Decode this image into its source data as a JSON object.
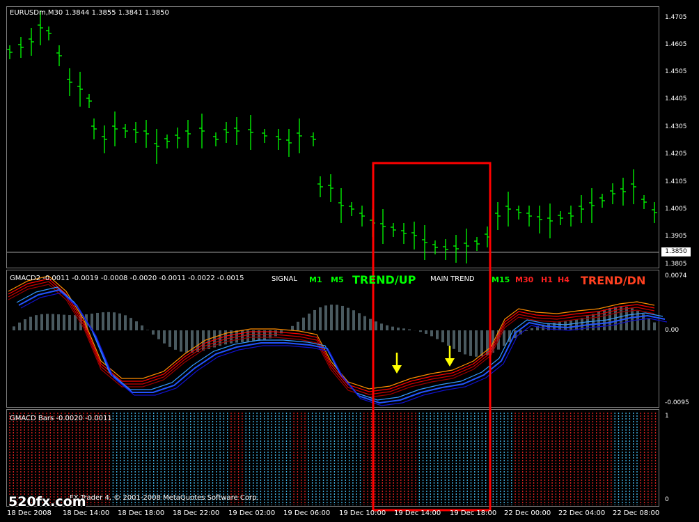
{
  "main_chart": {
    "title": "EURUSDm,M30  1.3844 1.3855 1.3841 1.3850",
    "current_price": "1.3850",
    "price_labels": [
      "1.4705",
      "1.4605",
      "1.4505",
      "1.4405",
      "1.4305",
      "1.4205",
      "1.4105",
      "1.4005",
      "1.3905",
      "1.3805"
    ]
  },
  "gmacd2": {
    "title": "GMACD2 -0.0011 -0.0019 -0.0008 -0.0020 -0.0011 -0.0022 -0.0015",
    "signal_label": "SIGNAL",
    "m1": "M1",
    "m5": "M5",
    "trend_up": "TREND/UP",
    "main_trend_label": "MAIN TREND",
    "m15": "M15",
    "m30": "M30",
    "h1": "H1",
    "h4": "H4",
    "trend_dn": "TREND/DN",
    "axis_labels": [
      "0.0074",
      "0.00",
      "-0.0095"
    ]
  },
  "gmacd_bars": {
    "title": "GMACD Bars -0.0020 -0.0011",
    "axis_labels": [
      "1",
      "0"
    ]
  },
  "time_labels": [
    "18 Dec 2008",
    "18 Dec 14:00",
    "18 Dec 18:00",
    "18 Dec 22:00",
    "19 Dec 02:00",
    "19 Dec 06:00",
    "19 Dec 10:00",
    "19 Dec 14:00",
    "19 Dec 18:00",
    "22 Dec 00:00",
    "22 Dec 04:00",
    "22 Dec 08:00"
  ],
  "footer": {
    "copyright": "FX Trader 4, © 2001-2008 MetaQuotes Software Corp.",
    "watermark": "520fx.com"
  },
  "colors": {
    "bull": "#00ff00",
    "highlight_box": "#ff0000",
    "signal_arrow": "#ffff00",
    "trend_up": "#00ff00",
    "trend_dn": "#ff4020"
  }
}
